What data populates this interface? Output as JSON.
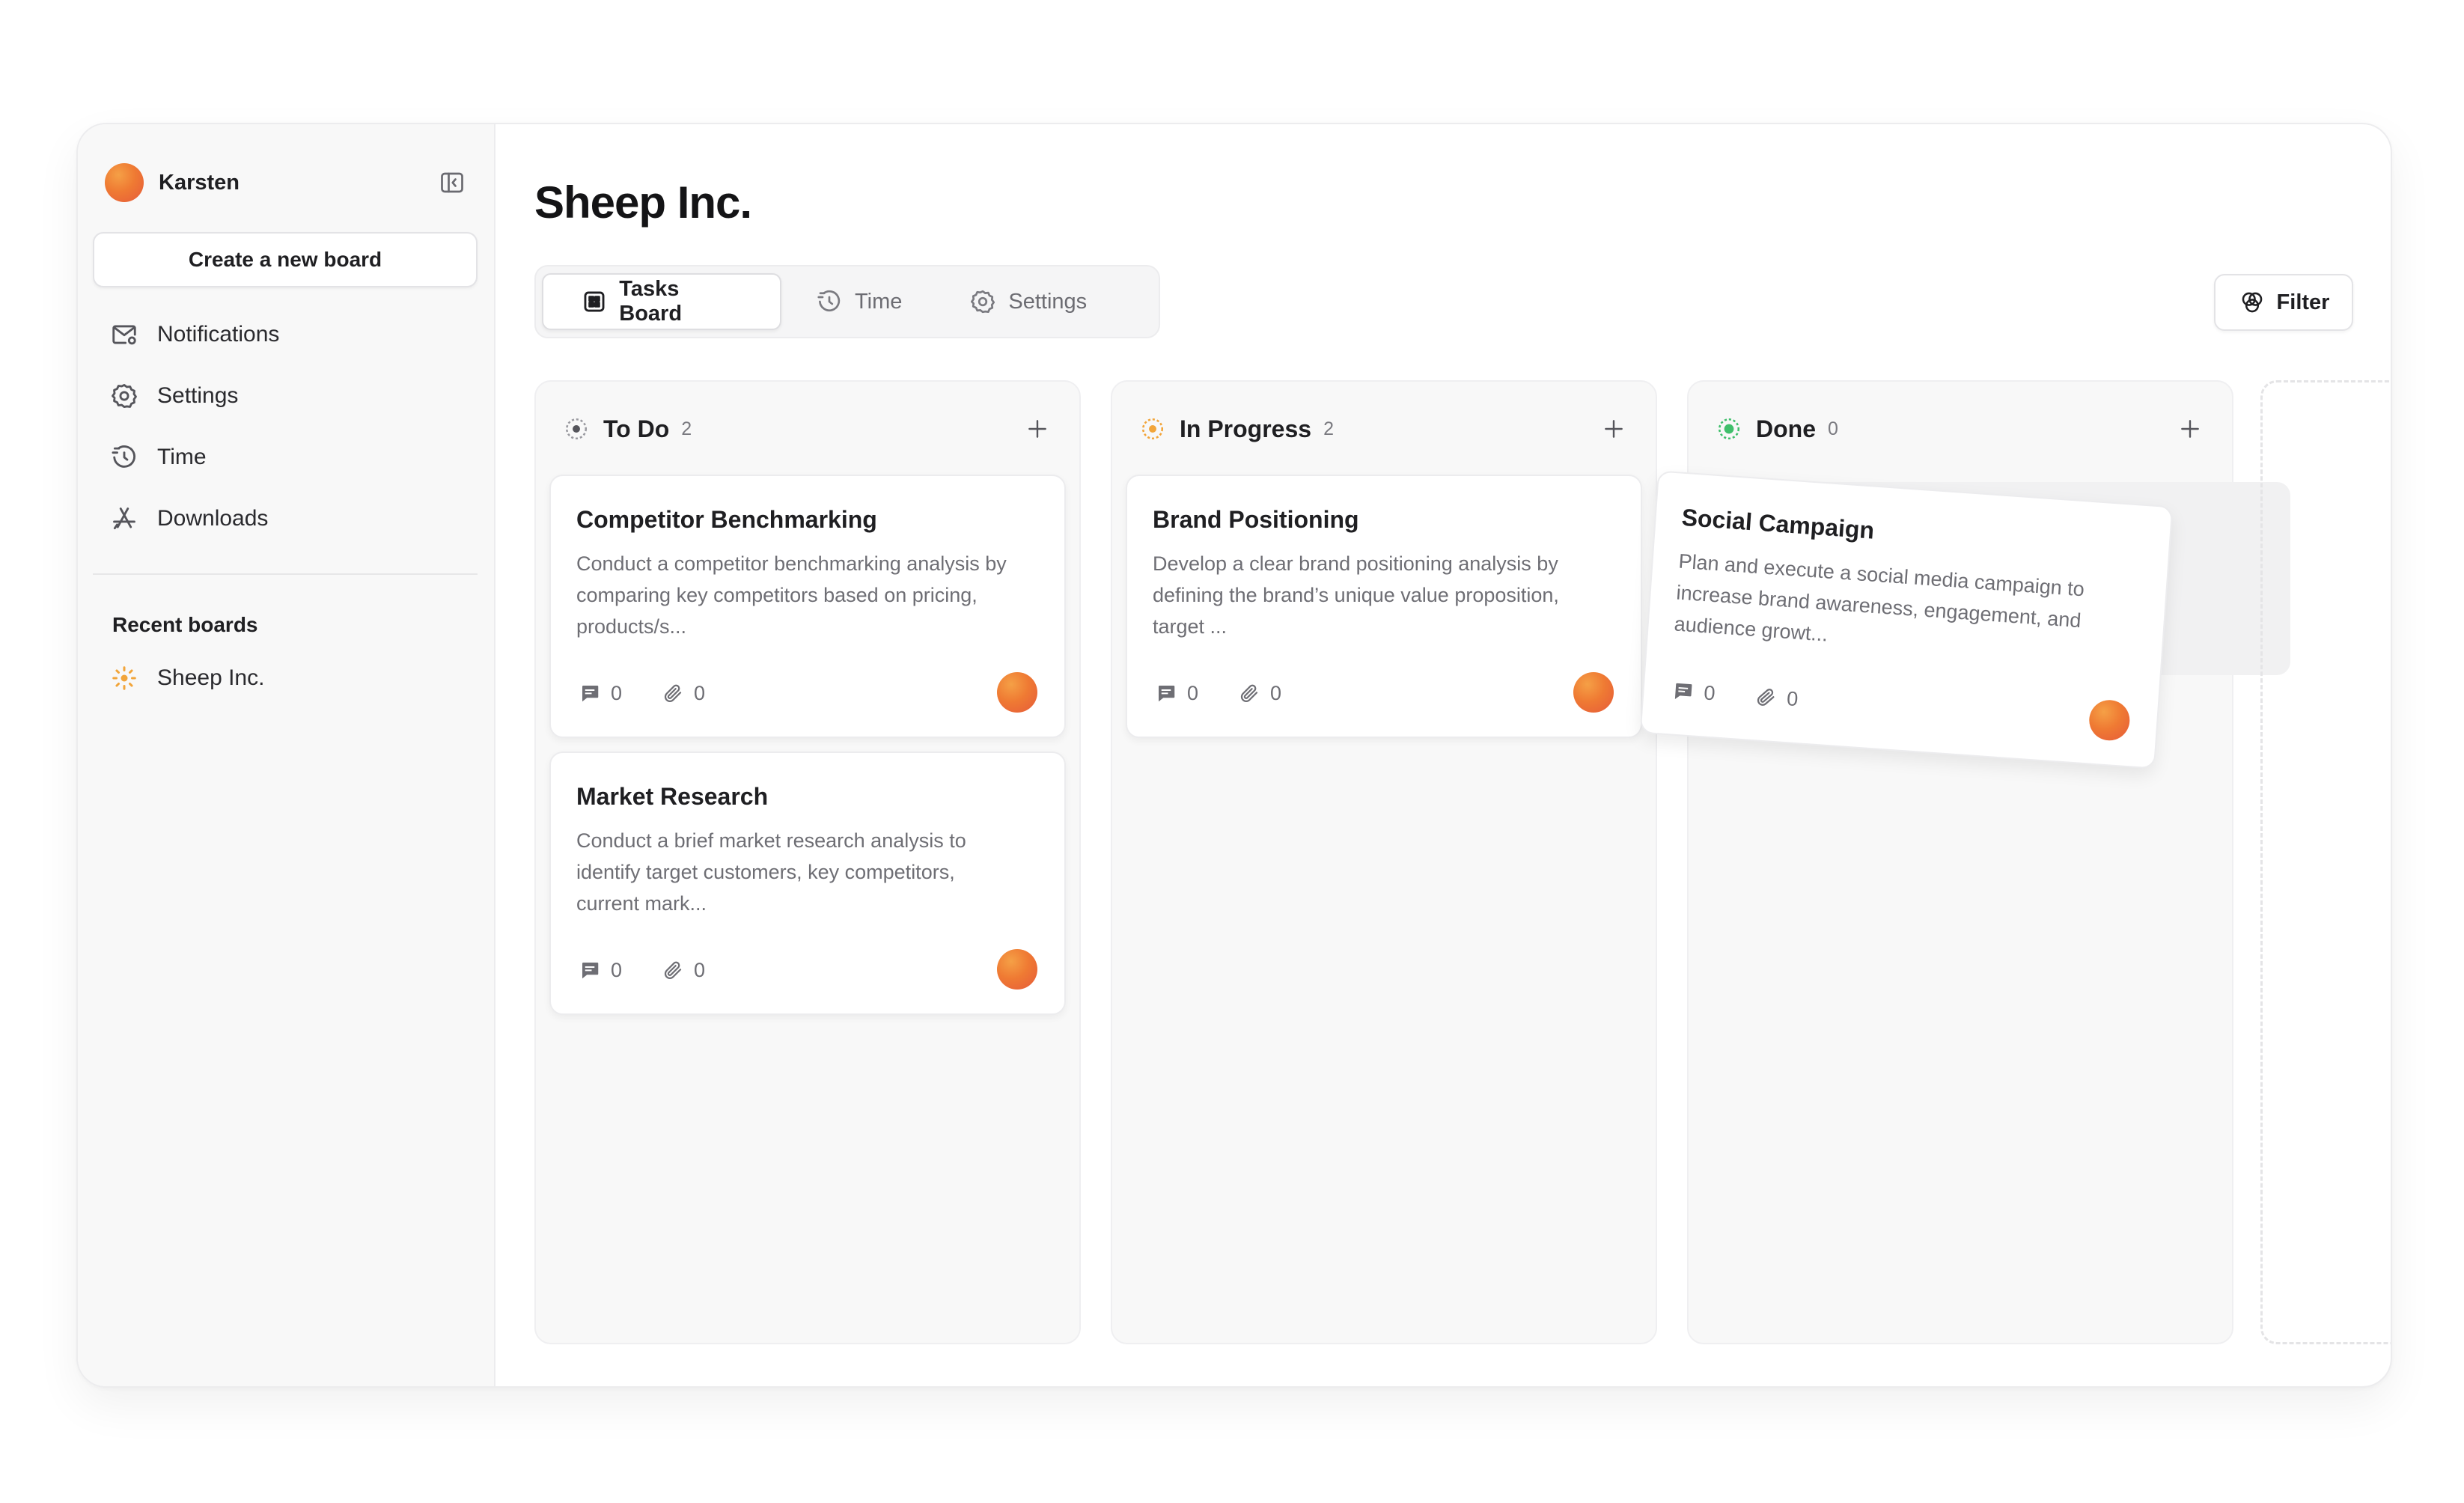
{
  "user": {
    "name": "Karsten"
  },
  "sidebar": {
    "create_label": "Create a new board",
    "nav": [
      {
        "label": "Notifications",
        "icon": "mail-icon"
      },
      {
        "label": "Settings",
        "icon": "gear-icon"
      },
      {
        "label": "Time",
        "icon": "timer-icon"
      },
      {
        "label": "Downloads",
        "icon": "app-store-icon"
      }
    ],
    "recent_title": "Recent boards",
    "recent": [
      {
        "label": "Sheep Inc.",
        "icon": "loader-icon"
      }
    ]
  },
  "page": {
    "title": "Sheep Inc.",
    "tabs": [
      {
        "label": "Tasks Board",
        "active": true
      },
      {
        "label": "Time",
        "active": false
      },
      {
        "label": "Settings",
        "active": false
      }
    ],
    "filter_label": "Filter"
  },
  "columns": [
    {
      "title": "To Do",
      "count": "2",
      "status_color": "#8a8a8f",
      "cards": [
        {
          "title": "Competitor Benchmarking",
          "desc": "Conduct a competitor benchmarking analysis by comparing key competitors based on pricing, products/s...",
          "comments": "0",
          "attachments": "0"
        },
        {
          "title": "Market Research",
          "desc": "Conduct a brief market research analysis to identify target customers, key competitors, current mark...",
          "comments": "0",
          "attachments": "0"
        }
      ]
    },
    {
      "title": "In Progress",
      "count": "2",
      "status_color": "#f2a53a",
      "cards": [
        {
          "title": "Brand Positioning",
          "desc": "Develop a clear brand positioning analysis by defining the brand’s unique value proposition, target ...",
          "comments": "0",
          "attachments": "0"
        }
      ]
    },
    {
      "title": "Done",
      "count": "0",
      "status_color": "#3fbf6b",
      "cards": [
        {
          "title": "Social Campaign",
          "desc": "Plan and execute a social media campaign to increase brand awareness, engagement, and audience growt...",
          "comments": "0",
          "attachments": "0"
        }
      ]
    }
  ],
  "colors": {
    "accent_avatar": "#ef7a33",
    "border": "#ececee"
  }
}
